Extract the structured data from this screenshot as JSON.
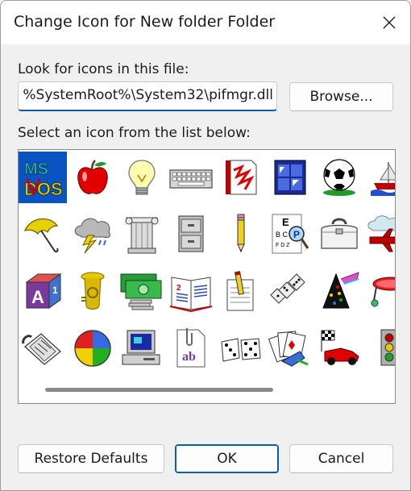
{
  "window": {
    "title": "Change Icon for New folder Folder"
  },
  "file": {
    "label": "Look for icons in this file:",
    "value": "%SystemRoot%\\System32\\pifmgr.dll",
    "browse_label": "Browse..."
  },
  "list": {
    "label": "Select an icon from the list below:",
    "selected_index": 0,
    "icons": [
      "ms-dos-icon",
      "apple-icon",
      "light-bulb-icon",
      "keyboard-icon",
      "document-scribble-icon",
      "window-icon",
      "soccer-ball-icon",
      "ship-icon",
      "umbrella-icon",
      "storm-cloud-icon",
      "column-icon",
      "filing-cabinet-icon",
      "pencil-icon",
      "eye-chart-icon",
      "doctor-bag-icon",
      "airplane-cloud-icon",
      "alphabet-block-icon",
      "tuba-icon",
      "money-icon",
      "open-book-icon",
      "notepad-pencil-icon",
      "dominoes-icon",
      "party-hat-icon",
      "trampoline-icon",
      "telephone-icon",
      "beach-ball-icon",
      "computer-icon",
      "document-ab-icon",
      "dice-icon",
      "playing-cards-icon",
      "race-car-icon",
      "traffic-light-icon"
    ]
  },
  "buttons": {
    "restore": "Restore Defaults",
    "ok": "OK",
    "cancel": "Cancel"
  },
  "colors": {
    "accent": "#0a53c3",
    "selection": "#0a53c3"
  }
}
